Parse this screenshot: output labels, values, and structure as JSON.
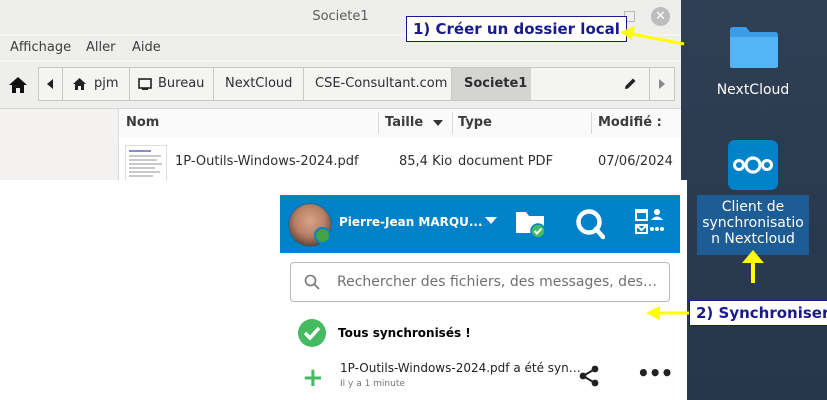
{
  "file_manager": {
    "title": "Societe1",
    "menu": [
      "Affichage",
      "Aller",
      "Aide"
    ],
    "breadcrumbs": [
      "pjm",
      "Bureau",
      "NextCloud",
      "CSE-Consultant.com",
      "Societe1"
    ],
    "columns": {
      "name": "Nom",
      "size": "Taille",
      "type": "Type",
      "modified": "Modifié :"
    },
    "files": [
      {
        "name": "1P-Outils-Windows-2024.pdf",
        "size": "85,4 Kio",
        "type": "document PDF",
        "modified": "07/06/2024"
      }
    ]
  },
  "nextcloud_client": {
    "user_name": "Pierre-Jean MARQU...",
    "search_placeholder": "Rechercher des fichiers, des messages, des…",
    "sync_status": "Tous synchronisés !",
    "activity_text": "1P-Outils-Windows-2024.pdf a été syn…",
    "activity_time": "Il y a 1 minute"
  },
  "desktop": {
    "folder_label": "NextCloud",
    "client_label_lines": [
      "Client de",
      "synchronisatio",
      "n Nextcloud"
    ]
  },
  "annotations": {
    "step1": "1) Créer un dossier local",
    "step2": "2) Synchroniser"
  },
  "colors": {
    "nextcloud_blue": "#0082c9",
    "sync_green": "#46ba61",
    "annotation_arrow": "#ffff00",
    "annotation_text": "#1a1a8c"
  },
  "icons": [
    "home-icon",
    "folder-icon",
    "search-icon",
    "check-icon",
    "plus-icon",
    "share-icon",
    "more-icon",
    "pencil-icon"
  ]
}
